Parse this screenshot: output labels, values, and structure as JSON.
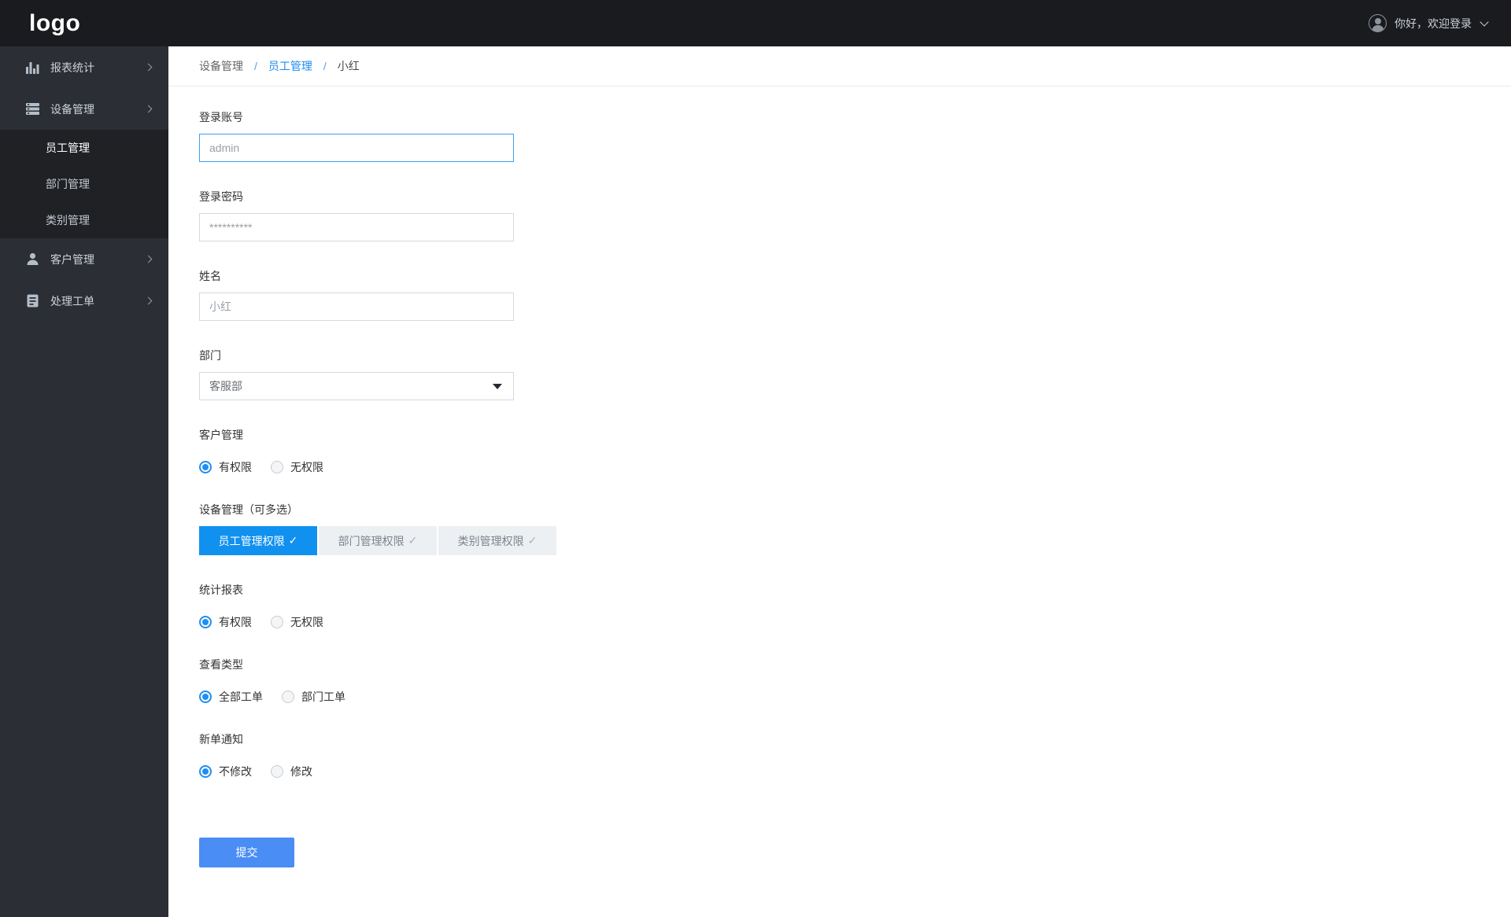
{
  "header": {
    "logo_text": "logo",
    "greeting": "你好，欢迎登录"
  },
  "sidebar": {
    "items": [
      {
        "label": "报表统计",
        "icon": "bar-chart-icon",
        "expandable": true
      },
      {
        "label": "设备管理",
        "icon": "server-icon",
        "expandable": true,
        "expanded": true,
        "submenu": [
          {
            "label": "员工管理",
            "active": true
          },
          {
            "label": "部门管理",
            "active": false
          },
          {
            "label": "类别管理",
            "active": false
          }
        ]
      },
      {
        "label": "客户管理",
        "icon": "user-icon",
        "expandable": true
      },
      {
        "label": "处理工单",
        "icon": "document-icon",
        "expandable": true
      }
    ]
  },
  "breadcrumb": {
    "separator": "/",
    "items": [
      {
        "label": "设备管理",
        "state": "link"
      },
      {
        "label": "员工管理",
        "state": "active"
      },
      {
        "label": "小红",
        "state": "current"
      }
    ]
  },
  "form": {
    "fields": {
      "account": {
        "label": "登录账号",
        "value": "admin",
        "focused": true
      },
      "password": {
        "label": "登录密码",
        "value": "**********"
      },
      "name": {
        "label": "姓名",
        "value": "小红"
      },
      "department": {
        "label": "部门",
        "value": "客服部"
      }
    },
    "multiselect": {
      "label": "设备管理（可多选）",
      "check_glyph": "✓",
      "options": [
        {
          "label": "员工管理权限",
          "selected": true
        },
        {
          "label": "部门管理权限",
          "selected": false
        },
        {
          "label": "类别管理权限",
          "selected": false
        }
      ]
    },
    "radio_groups": {
      "customer_mgmt": {
        "label": "客户管理",
        "options": [
          {
            "label": "有权限",
            "selected": true
          },
          {
            "label": "无权限",
            "selected": false
          }
        ]
      },
      "report": {
        "label": "统计报表",
        "options": [
          {
            "label": "有权限",
            "selected": true
          },
          {
            "label": "无权限",
            "selected": false
          }
        ]
      },
      "view_type": {
        "label": "查看类型",
        "options": [
          {
            "label": "全部工单",
            "selected": true
          },
          {
            "label": "部门工单",
            "selected": false
          }
        ]
      },
      "notification": {
        "label": "新单通知",
        "options": [
          {
            "label": "不修改",
            "selected": true
          },
          {
            "label": "修改",
            "selected": false
          }
        ]
      }
    },
    "submit_label": "提交"
  },
  "colors": {
    "header_bg": "#191b1f",
    "sidebar_bg": "#2b2e34",
    "submenu_bg": "#1f2125",
    "accent_blue": "#1191ef",
    "link_blue": "#1e8cee",
    "submit_blue": "#4a8df5",
    "focused_border": "#3d9ff0"
  }
}
